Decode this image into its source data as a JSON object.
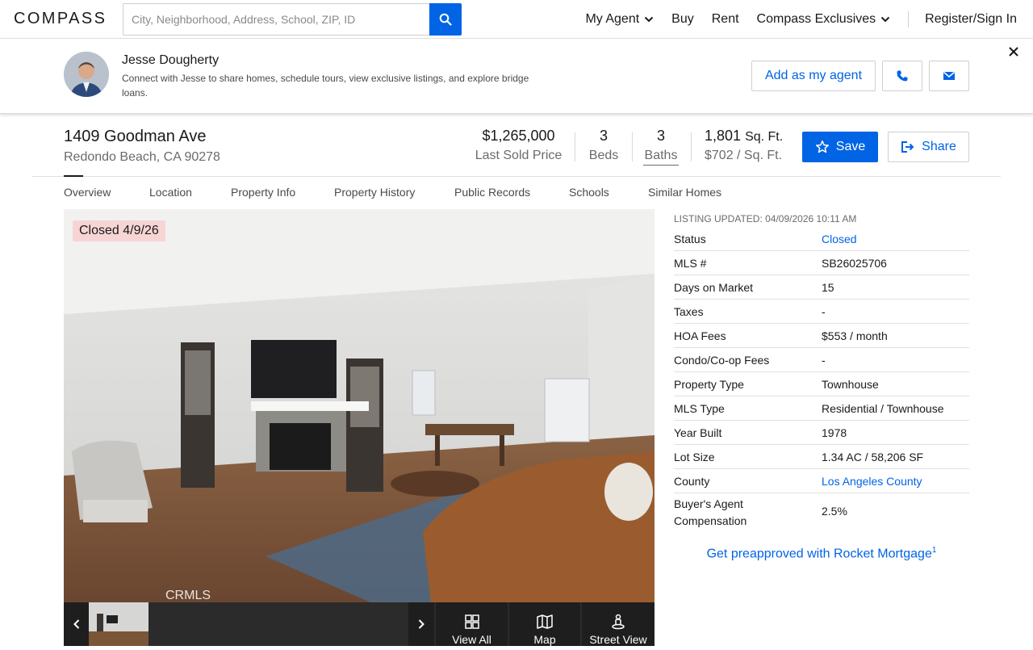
{
  "header": {
    "logo": "COMPASS",
    "search_placeholder": "City, Neighborhood, Address, School, ZIP, ID",
    "nav": {
      "my_agent": "My Agent",
      "buy": "Buy",
      "rent": "Rent",
      "exclusives": "Compass Exclusives",
      "signin": "Register/Sign In"
    }
  },
  "agent": {
    "name": "Jesse Dougherty",
    "description": "Connect with Jesse to share homes, schedule tours, view exclusive listings, and explore bridge loans.",
    "add_label": "Add as my agent"
  },
  "listing": {
    "address1": "1409 Goodman Ave",
    "address2": "Redondo Beach, CA 90278",
    "price": "$1,265,000",
    "price_label": "Last Sold Price",
    "beds": "3",
    "beds_label": "Beds",
    "baths": "3",
    "baths_label": "Baths",
    "sqft": "1,801",
    "sqft_unit": "Sq. Ft.",
    "price_per_sqft": "$702 / Sq. Ft.",
    "save_label": "Save",
    "share_label": "Share"
  },
  "tabs": [
    "Overview",
    "Location",
    "Property Info",
    "Property History",
    "Public Records",
    "Schools",
    "Similar Homes"
  ],
  "photo": {
    "badge": "Closed 4/9/26",
    "watermark": "CRMLS",
    "view_all": "View All",
    "map": "Map",
    "street_view": "Street View"
  },
  "details": {
    "updated": "LISTING UPDATED: 04/09/2026 10:11 AM",
    "rows": [
      {
        "k": "Status",
        "v": "Closed"
      },
      {
        "k": "MLS #",
        "v": "SB26025706"
      },
      {
        "k": "Days on Market",
        "v": "15"
      },
      {
        "k": "Taxes",
        "v": "-"
      },
      {
        "k": "HOA Fees",
        "v": "$553 / month"
      },
      {
        "k": "Condo/Co-op Fees",
        "v": "-"
      },
      {
        "k": "Property Type",
        "v": "Townhouse"
      },
      {
        "k": "MLS Type",
        "v": "Residential / Townhouse"
      },
      {
        "k": "Year Built",
        "v": "1978"
      },
      {
        "k": "Lot Size",
        "v": "1.34 AC / 58,206 SF"
      },
      {
        "k": "County",
        "v": "Los Angeles County"
      },
      {
        "k": "Buyer's Agent Compensation",
        "v": "2.5%"
      }
    ],
    "rocket": "Get preapproved with Rocket Mortgage",
    "rocket_sup": "1"
  },
  "colors": {
    "accent": "#0064e5",
    "badge_bg": "#f7d5d5"
  }
}
